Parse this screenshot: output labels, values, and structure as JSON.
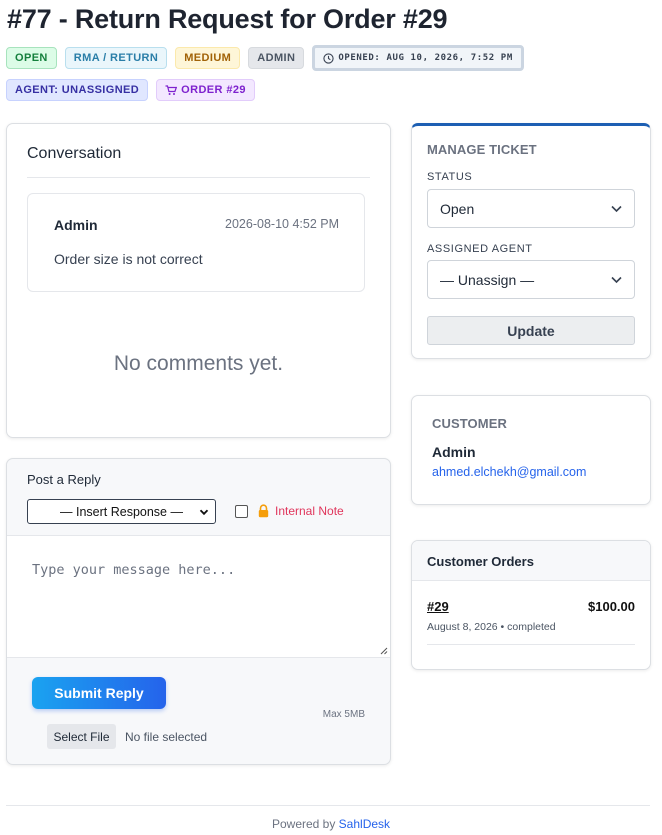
{
  "ticket": {
    "title": "#77 - Return Request for Order #29"
  },
  "badges": {
    "status": "OPEN",
    "category": "RMA / RETURN",
    "priority": "MEDIUM",
    "source": "ADMIN",
    "opened": "OPENED: AUG 10, 2026, 7:52 PM",
    "agent": "AGENT: UNASSIGNED",
    "order": "ORDER #29"
  },
  "conversation": {
    "title": "Conversation",
    "messages": [
      {
        "author": "Admin",
        "date": "2026-08-10 4:52 PM",
        "body": "Order size is not correct"
      }
    ],
    "empty_text": "No comments yet."
  },
  "reply": {
    "title": "Post a Reply",
    "insert_response": "— Insert Response —",
    "internal_note_label": "Internal Note",
    "internal_note_checked": false,
    "message_placeholder": "Type your message here...",
    "submit_label": "Submit Reply",
    "max_size": "Max 5MB",
    "file_button": "Select File",
    "file_status": "No file selected"
  },
  "manage": {
    "title": "MANAGE TICKET",
    "status_label": "STATUS",
    "status_value": "Open",
    "agent_label": "ASSIGNED AGENT",
    "agent_value": "— Unassign —",
    "update_label": "Update"
  },
  "customer": {
    "title": "CUSTOMER",
    "name": "Admin",
    "email": "ahmed.elchekh@gmail.com"
  },
  "orders": {
    "title": "Customer Orders",
    "items": [
      {
        "id": "#29",
        "total": "$100.00",
        "meta": "August 8, 2026 • completed"
      }
    ]
  },
  "footer": {
    "prefix": "Powered by ",
    "brand": "SahlDesk"
  },
  "colors": {
    "accent": "#2563eb",
    "manage_border": "#1d5fb3",
    "internal_note": "#e0355b"
  }
}
